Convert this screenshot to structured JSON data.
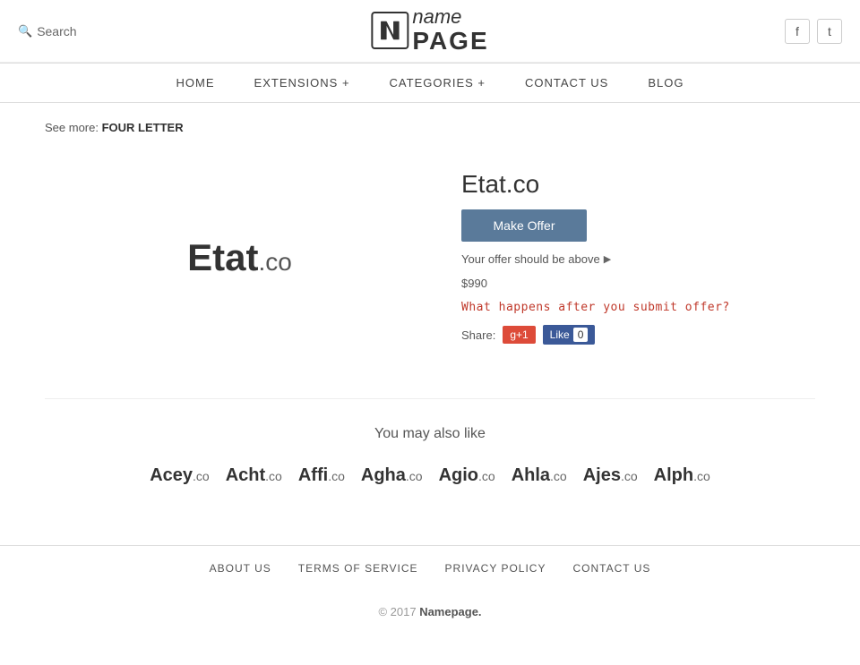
{
  "header": {
    "search_label": "Search",
    "logo_icon": "n",
    "logo_name": "name",
    "logo_page": "PAGE",
    "facebook_icon": "f",
    "twitter_icon": "t"
  },
  "nav": {
    "items": [
      {
        "label": "HOME",
        "id": "home"
      },
      {
        "label": "EXTENSIONS +",
        "id": "extensions"
      },
      {
        "label": "CATEGORIES +",
        "id": "categories"
      },
      {
        "label": "CONTACT US",
        "id": "contact"
      },
      {
        "label": "BLOG",
        "id": "blog"
      }
    ]
  },
  "see_more": {
    "prefix": "See more:",
    "link_label": "FOUR LETTER"
  },
  "domain": {
    "name": "Etat",
    "tld": ".co",
    "full": "Etat.co",
    "make_offer_label": "Make Offer",
    "offer_note_line1": "Your offer should be above",
    "offer_note_line2": "$990",
    "submit_link_label": "What happens after you submit offer?",
    "share_label": "Share:",
    "gplus_label": "g+1",
    "fb_label": "Like",
    "fb_count": "0"
  },
  "also_like": {
    "title": "You may also like",
    "domains": [
      {
        "name": "Acey",
        "tld": ".co"
      },
      {
        "name": "Acht",
        "tld": ".co"
      },
      {
        "name": "Affi",
        "tld": ".co"
      },
      {
        "name": "Agha",
        "tld": ".co"
      },
      {
        "name": "Agio",
        "tld": ".co"
      },
      {
        "name": "Ahla",
        "tld": ".co"
      },
      {
        "name": "Ajes",
        "tld": ".co"
      },
      {
        "name": "Alph",
        "tld": ".co"
      }
    ]
  },
  "footer": {
    "links": [
      {
        "label": "ABOUT US",
        "id": "about"
      },
      {
        "label": "TERMS OF SERVICE",
        "id": "terms"
      },
      {
        "label": "PRIVACY POLICY",
        "id": "privacy"
      },
      {
        "label": "CONTACT US",
        "id": "contact"
      }
    ],
    "copy": "© 2017",
    "brand": "Namepage."
  }
}
